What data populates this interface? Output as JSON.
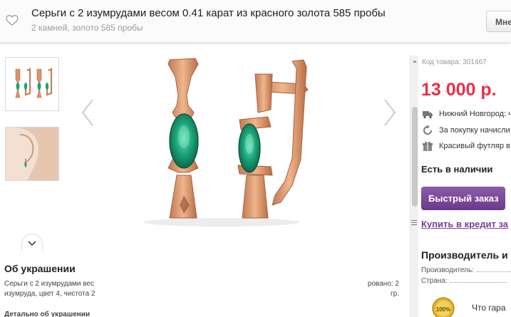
{
  "header": {
    "title": "Серьги с 2 изумрудами весом 0.41 карат из красного золота 585 пробы",
    "subtitle": "2 камней, золото 585 пробы",
    "menu_button": "Мне",
    "favorite_icon": "heart-icon"
  },
  "gallery": {
    "thumbnails": [
      "earrings-pair-thumb",
      "earring-on-ear-thumb"
    ],
    "more_icon": "chevron-down-icon",
    "prev_icon": "chevron-left-icon",
    "next_icon": "chevron-right-icon"
  },
  "product": {
    "sku": "Код товара: 301467",
    "price": "13 000 р.",
    "delivery": "Нижний Новгород: ч",
    "bonus": "За покупку начисли",
    "gift": "Красивый футляр в",
    "stock": "Есть в наличии",
    "quick_order": "Быстрый заказ",
    "credit_link": "Купить в кредит за"
  },
  "manufacturer": {
    "title": "Производитель и",
    "maker_label": "Производитель:",
    "country_label": "Страна:"
  },
  "guarantee": {
    "badge_text": "100%",
    "text": "Что гара"
  },
  "description": {
    "title": "Об украшении",
    "text_left": "Серьги с 2 изумрудами вес изумруда, цвет 4, чистота 2",
    "text_right_1": "ровано: 2",
    "text_right_2": "гр.",
    "detail_title": "Детально об украшении"
  },
  "colors": {
    "price": "#e8304a",
    "button": "#6c3a8b",
    "link": "#7a3f93"
  }
}
